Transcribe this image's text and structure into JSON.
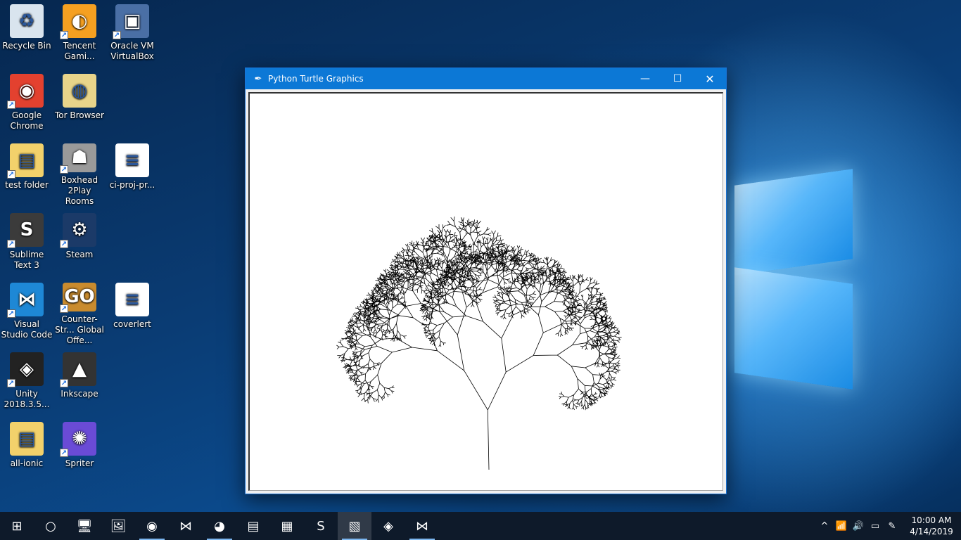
{
  "desktop": {
    "icons": [
      {
        "label": "Recycle Bin",
        "icon": "recycle-bin-icon",
        "color": "#d9e4ee",
        "glyph": "♻",
        "shortcut": false
      },
      {
        "label": "Tencent Gami...",
        "icon": "tencent-gaming-icon",
        "color": "#f5a021",
        "glyph": "◐",
        "shortcut": true
      },
      {
        "label": "Oracle VM VirtualBox",
        "icon": "virtualbox-icon",
        "color": "#4a6fa5",
        "glyph": "▣",
        "shortcut": true
      },
      {
        "label": "Google Chrome",
        "icon": "chrome-icon",
        "color": "#e3412f",
        "glyph": "◉",
        "shortcut": true
      },
      {
        "label": "Tor Browser",
        "icon": "tor-browser-icon",
        "color": "#e8d48a",
        "glyph": "◍",
        "shortcut": false
      },
      {
        "label": "test folder",
        "icon": "folder-icon",
        "color": "#f2d16b",
        "glyph": "▤",
        "shortcut": true
      },
      {
        "label": "Boxhead 2Play Rooms",
        "icon": "boxhead-icon",
        "color": "#9a9a9a",
        "glyph": "☗",
        "shortcut": true
      },
      {
        "label": "ci-proj-pr...",
        "icon": "word-document-icon",
        "color": "#ffffff",
        "glyph": "≡",
        "shortcut": false
      },
      {
        "label": "Sublime Text 3",
        "icon": "sublime-text-icon",
        "color": "#3b3b3b",
        "glyph": "S",
        "shortcut": true
      },
      {
        "label": "Steam",
        "icon": "steam-icon",
        "color": "#1b3a68",
        "glyph": "⚙",
        "shortcut": true
      },
      {
        "label": "Visual Studio Code",
        "icon": "vscode-icon",
        "color": "#1e88d6",
        "glyph": "⋈",
        "shortcut": true
      },
      {
        "label": "Counter-Str... Global Offe...",
        "icon": "csgo-icon",
        "color": "#c98b2e",
        "glyph": "GO",
        "shortcut": true
      },
      {
        "label": "coverlert",
        "icon": "word-document-icon",
        "color": "#ffffff",
        "glyph": "≡",
        "shortcut": false
      },
      {
        "label": "Unity 2018.3.5...",
        "icon": "unity-icon",
        "color": "#222222",
        "glyph": "◈",
        "shortcut": true
      },
      {
        "label": "Inkscape",
        "icon": "inkscape-icon",
        "color": "#333333",
        "glyph": "▲",
        "shortcut": true
      },
      {
        "label": "all-ionic",
        "icon": "folder-icon",
        "color": "#f2d16b",
        "glyph": "▤",
        "shortcut": false
      },
      {
        "label": "Spriter",
        "icon": "spriter-icon",
        "color": "#6a4bd6",
        "glyph": "✺",
        "shortcut": true
      }
    ]
  },
  "window": {
    "title": "Python Turtle Graphics",
    "minimize_glyph": "—",
    "maximize_glyph": "☐",
    "close_glyph": "✕"
  },
  "taskbar": {
    "items": [
      {
        "name": "start-button",
        "glyph": "⊞",
        "active": false,
        "running": false
      },
      {
        "name": "search-button",
        "glyph": "○",
        "active": false,
        "running": false
      },
      {
        "name": "taskbar-this-pc",
        "glyph": "🖥",
        "active": false,
        "running": false
      },
      {
        "name": "taskbar-photos",
        "glyph": "🖼",
        "active": false,
        "running": false
      },
      {
        "name": "taskbar-github",
        "glyph": "◉",
        "active": false,
        "running": true
      },
      {
        "name": "taskbar-vscode",
        "glyph": "⋈",
        "active": false,
        "running": false
      },
      {
        "name": "taskbar-firefox",
        "glyph": "◕",
        "active": false,
        "running": true
      },
      {
        "name": "taskbar-file-explorer",
        "glyph": "▤",
        "active": false,
        "running": false
      },
      {
        "name": "taskbar-image-viewer",
        "glyph": "▦",
        "active": false,
        "running": false
      },
      {
        "name": "taskbar-sublime",
        "glyph": "S",
        "active": false,
        "running": false
      },
      {
        "name": "taskbar-python",
        "glyph": "▧",
        "active": true,
        "running": true
      },
      {
        "name": "taskbar-unity",
        "glyph": "◈",
        "active": false,
        "running": false
      },
      {
        "name": "taskbar-visual-studio",
        "glyph": "⋈",
        "active": false,
        "running": true
      }
    ],
    "tray": {
      "chevron": "^",
      "time": "10:00 AM",
      "date": "4/14/2019"
    }
  }
}
